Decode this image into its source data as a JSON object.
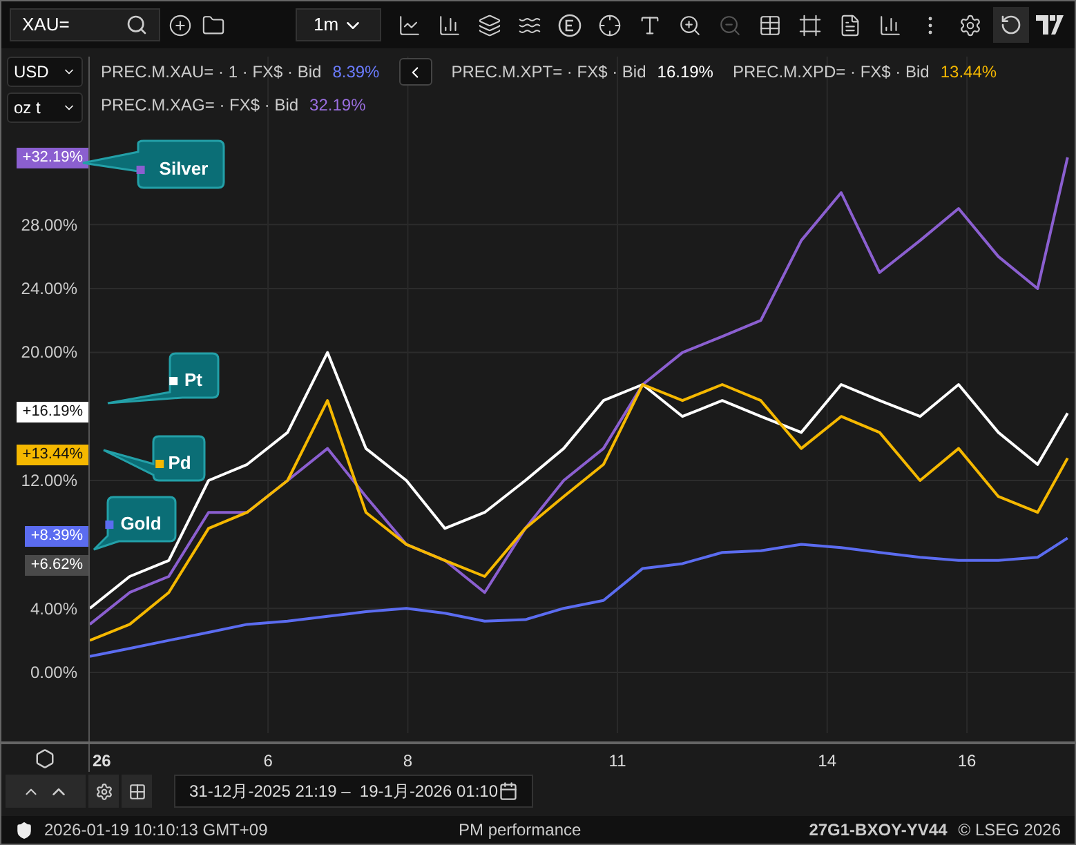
{
  "toolbar": {
    "search": {
      "value": "XAU="
    },
    "interval": "1m"
  },
  "units": [
    {
      "label": "USD"
    },
    {
      "label": "oz t"
    }
  ],
  "legend": [
    {
      "text": "PREC.M.XAU= · 1 · FX$ · Bid",
      "value": "8.39%",
      "color": "#6b7cff"
    },
    {
      "text": "PREC.M.XPT= · FX$ · Bid",
      "value": "16.19%",
      "color": "#ffffff"
    },
    {
      "text": "PREC.M.XPD= · FX$ · Bid",
      "value": "13.44%",
      "color": "#f5b800"
    },
    {
      "text": "PREC.M.XAG= · FX$ · Bid",
      "value": "32.19%",
      "color": "#9b6fe0"
    }
  ],
  "axis_badges": [
    {
      "text": "+32.19%",
      "color": "#8b5fd0"
    },
    {
      "text": "+16.19%",
      "color": "#ffffff"
    },
    {
      "text": "+13.44%",
      "color": "#f5b800"
    },
    {
      "text": "+8.39%",
      "color": "#5b6cf0"
    },
    {
      "text": "+6.62%",
      "color": "#4a4a4a"
    }
  ],
  "year_label": "26",
  "chart_data": {
    "type": "line",
    "x": [
      3.45,
      4.02,
      4.58,
      5.15,
      5.7,
      6.28,
      6.85,
      7.4,
      7.98,
      8.53,
      9.1,
      9.68,
      10.23,
      10.8,
      11.36,
      11.93,
      12.5,
      13.05,
      13.63,
      14.2,
      14.75,
      15.33,
      15.88,
      16.45,
      17.01,
      17.44
    ],
    "xticks": [
      6,
      8,
      11,
      14,
      16
    ],
    "yticks": [
      {
        "value": 0,
        "label": "0.00%"
      },
      {
        "value": 4,
        "label": "4.00%"
      },
      {
        "value": 12,
        "label": "12.00%"
      },
      {
        "value": 20,
        "label": "20.00%"
      },
      {
        "value": 24,
        "label": "24.00%"
      },
      {
        "value": 28,
        "label": "28.00%"
      }
    ],
    "ylim": [
      -3.8,
      38.5
    ],
    "xlim": [
      2.185,
      17.58
    ],
    "grid": true,
    "legend": "left",
    "series": [
      {
        "name": "Gold",
        "color": "#5b6cf0",
        "values": [
          1,
          1.5,
          2,
          2.5,
          3,
          3.2,
          3.5,
          3.8,
          4,
          3.7,
          3.2,
          3.3,
          4,
          4.5,
          6.5,
          6.8,
          7.5,
          7.6,
          8,
          7.8,
          7.5,
          7.2,
          7,
          7,
          7.2,
          8.4
        ]
      },
      {
        "name": "Silver",
        "color": "#8b5fd0",
        "values": [
          3,
          5,
          6,
          10,
          10,
          12,
          14,
          11,
          8,
          7,
          5,
          9,
          12,
          14,
          18,
          20,
          21,
          22,
          27,
          30,
          25,
          27,
          29,
          26,
          24,
          32.2
        ]
      },
      {
        "name": "Pt",
        "color": "#ffffff",
        "values": [
          4,
          6,
          7,
          12,
          13,
          15,
          20,
          14,
          12,
          9,
          10,
          12,
          14,
          17,
          18,
          16,
          17,
          16,
          15,
          18,
          17,
          16,
          18,
          15,
          13,
          16.2
        ]
      },
      {
        "name": "Pd",
        "color": "#f5b800",
        "values": [
          2,
          3,
          5,
          9,
          10,
          12,
          17,
          10,
          8,
          7,
          6,
          9,
          11,
          13,
          18,
          17,
          18,
          17,
          14,
          16,
          15,
          12,
          14,
          11,
          10,
          13.4
        ]
      }
    ]
  },
  "date_range": "31-12月-2025 21:19 –  19-1月-2026 01:10",
  "status_bar": {
    "time": "2026-01-19 10:10:13 GMT+09",
    "title": "PM performance",
    "code": "27G1-BXOY-YV44",
    "copyright": "© LSEG 2026"
  }
}
